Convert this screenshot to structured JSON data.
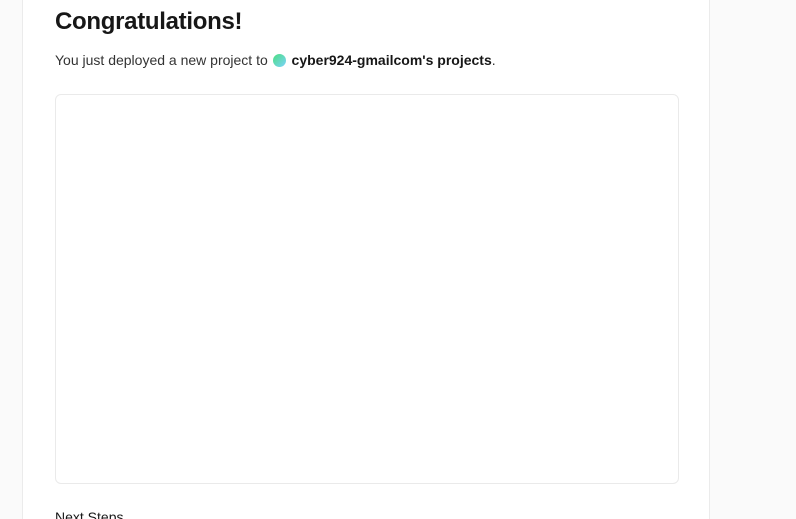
{
  "heading": {
    "title": "Congratulations!"
  },
  "deploy_message": {
    "prefix": "You just deployed a new project to",
    "team_name": "cyber924-gmailcom's projects",
    "suffix": "."
  },
  "sections": {
    "next_steps_label": "Next Steps"
  },
  "colors": {
    "avatar_gradient_start": "#4ade80",
    "avatar_gradient_end": "#7dd3fc",
    "page_background": "#fafafa",
    "card_background": "#ffffff"
  }
}
